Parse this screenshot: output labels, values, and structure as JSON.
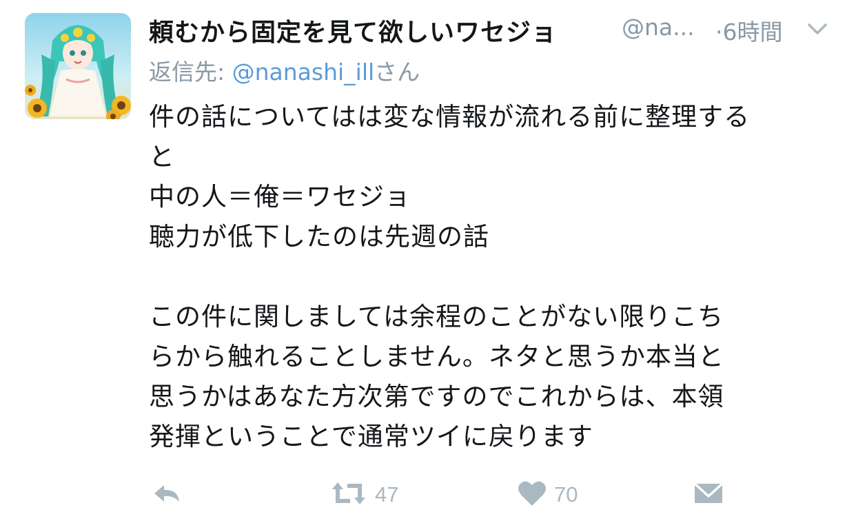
{
  "tweet": {
    "display_name": "頼むから固定を見て欲しいワセジョ",
    "handle": "@na...",
    "time": "·6時間",
    "reply_prefix": "返信先: ",
    "reply_to": "@nanashi_ill",
    "reply_suffix": "さん",
    "body_lines": [
      "件の話についてはは変な情報が流れる前に整理する",
      "と",
      "中の人＝俺＝ワセジョ",
      "聴力が低下したのは先週の話",
      "",
      "この件に関しましては余程のことがない限りこち",
      "らから触れることしません。ネタと思うか本当と",
      "思うかはあなた方次第ですのでこれからは、本領",
      "発揮ということで通常ツイに戻ります"
    ],
    "retweet_count": "47",
    "like_count": "70"
  },
  "icons": {
    "reply": "reply-arrow-icon",
    "retweet": "retweet-icon",
    "like": "heart-icon",
    "dm": "envelope-icon",
    "menu": "chevron-down-icon"
  },
  "colors": {
    "text": "#14171a",
    "secondary": "#8899a6",
    "mention": "#5a9bd5",
    "action_icon": "#aab8c2"
  }
}
